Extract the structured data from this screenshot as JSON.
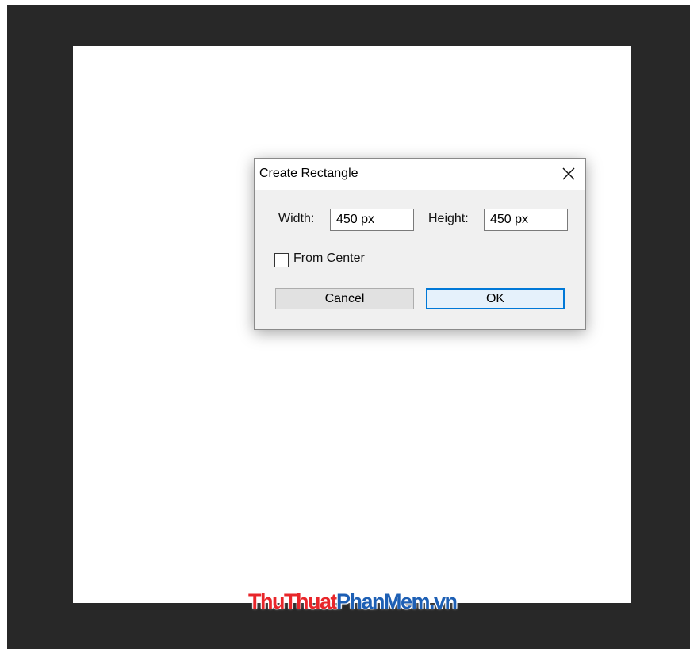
{
  "dialog": {
    "title": "Create Rectangle",
    "width_label": "Width:",
    "width_value": "450 px",
    "height_label": "Height:",
    "height_value": "450 px",
    "from_center_label": "From Center",
    "from_center_checked": false,
    "cancel_label": "Cancel",
    "ok_label": "OK"
  },
  "watermark": {
    "part1": "ThuThuat",
    "part2": "PhanMem.vn"
  },
  "colors": {
    "workspace": "#282828",
    "canvas": "#ffffff",
    "ok_border": "#0078d7",
    "watermark_red": "#e8262a",
    "watermark_blue": "#1d5fb4"
  }
}
